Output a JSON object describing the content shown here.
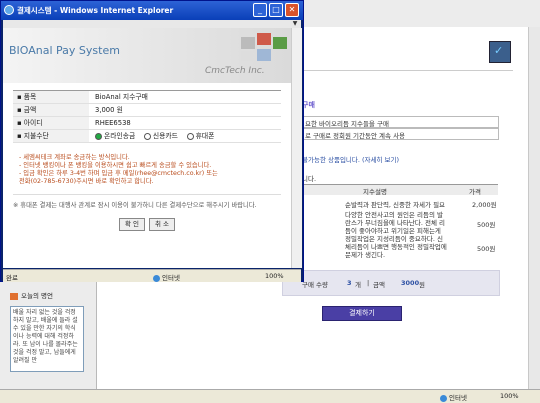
{
  "popup": {
    "title": "결제시스템 - Windows Internet Explorer",
    "brand": "BIOAnal Pay System",
    "company": "CmcTech Inc.",
    "rows": [
      {
        "label": "품목",
        "value": "BioAnal 지수구매"
      },
      {
        "label": "금액",
        "value": "3,000 원"
      },
      {
        "label": "아이디",
        "value": "RHEE6538"
      }
    ],
    "pay_method_label": "지불수단",
    "pay_options": [
      "온라인송금",
      "신용카드",
      "휴대폰"
    ],
    "notes": [
      "- 세엠씨테크 계좌로 송금하는 방식입니다.",
      "- 인터넷 뱅킹이나 폰 뱅킹을 이용하시면 쉽고 빠르게 송금할 수 있습니다.",
      "- 입금 확인은 하루 3-4번 하며 입금 후 메일(rhee@cmctech.co.kr) 또는",
      "  전화(02-785-6730)주시면 바로 확인하고 합니다."
    ],
    "footer_note": "※ 휴대폰 결제는 대행사 관계로 잠시 이용이 불가하니 다른 결제수단으로 해주시기 바랍니다.",
    "confirm_label": "확 인",
    "cancel_label": "취 소",
    "status_left": "완료",
    "status_zone": "인터넷",
    "status_zoom": "100%"
  },
  "background": {
    "heading": "구매",
    "line1": "요한 바이오리듬 지수들을 구매",
    "line2": "로 구매로 정회원 기간동안 계속 사용",
    "line3": "불가능한 상품입니다. (자세히 보기)",
    "line4": "니다.",
    "col_desc": "지수설명",
    "col_price": "가격",
    "items": [
      {
        "desc": "순발력과 판단력, 신중한 자세가 필요",
        "price": "2,000원"
      },
      {
        "desc": "다양한 안전사고의 원인은 리듬의 발란스가 무너짐을에 나타난다. 전체 리듬이 좋아야하고 위기일은 피해는게 좋다.",
        "price": "500원"
      },
      {
        "desc": "정밀작업은 지성리듬이 중요하다. 신체리듬이 나쁘면 행동적인 정밀작업에 문제가 생긴다.",
        "price": "500원"
      }
    ],
    "summary_label": "구매 수량",
    "summary_qty": "3",
    "summary_unit": "개",
    "summary_sep": "|",
    "summary_amount_label": "금액",
    "summary_amount": "3000",
    "summary_amount_unit": "원",
    "pay_button": "결제하기",
    "tab_label": "오늘의 명언",
    "memo": "배울 자리 없는 것을 걱정하지 말고, 배울에 들라 설 수 있을 만한 자기의 학식이나 능력에 대해 걱정하라. 또 남이 나를 몰라주는 것을 걱정 말고, 남들에게 알려질 만",
    "status_zone": "인터넷",
    "status_zoom": "100%"
  }
}
